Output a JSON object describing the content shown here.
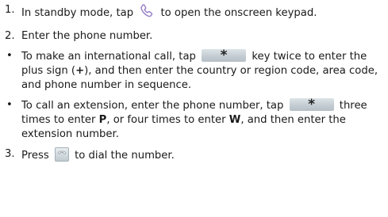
{
  "step1": {
    "num": "1.",
    "text_before": "In standby mode, tap",
    "text_after": "to open the onscreen keypad.",
    "icon": "phone-handset-icon",
    "icon_color": "#9b86c9"
  },
  "step2": {
    "num": "2.",
    "text": "Enter the phone number."
  },
  "bullet1": {
    "dot": "•",
    "text_before": "To make an international call, tap",
    "key_label": "*",
    "text_mid": "key twice to enter the plus sign (",
    "plus": "+",
    "text_after": "), and then enter the country or region code, area code, and phone number in sequence."
  },
  "bullet2": {
    "dot": "•",
    "text_before": "To call an extension, enter the phone number, tap",
    "key_label": "*",
    "text_mid1": "three times to enter",
    "letter_p": "P",
    "text_mid2": ", or four times to enter",
    "letter_w": "W",
    "text_after": ", and then enter the extension number."
  },
  "step3": {
    "num": "3.",
    "text_before": "Press",
    "text_after": "to dial the number.",
    "icon": "call-key-icon"
  }
}
